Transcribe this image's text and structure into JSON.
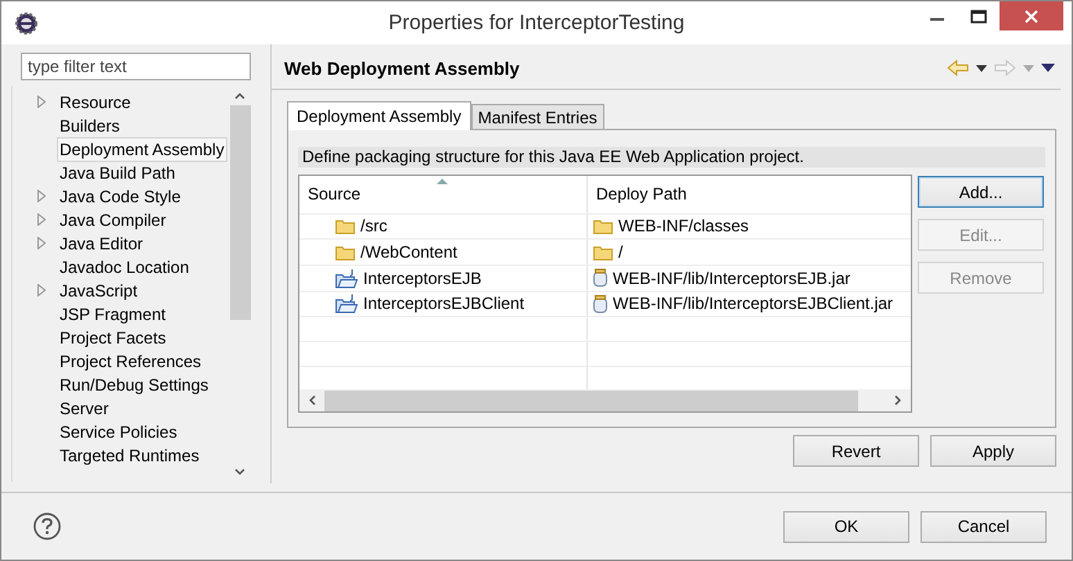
{
  "window": {
    "title": "Properties for InterceptorTesting"
  },
  "filter": {
    "placeholder": "type filter text"
  },
  "sidebar": {
    "items": [
      {
        "label": "Resource",
        "expandable": true,
        "selected": false
      },
      {
        "label": "Builders",
        "expandable": false,
        "selected": false
      },
      {
        "label": "Deployment Assembly",
        "expandable": false,
        "selected": true
      },
      {
        "label": "Java Build Path",
        "expandable": false,
        "selected": false
      },
      {
        "label": "Java Code Style",
        "expandable": true,
        "selected": false
      },
      {
        "label": "Java Compiler",
        "expandable": true,
        "selected": false
      },
      {
        "label": "Java Editor",
        "expandable": true,
        "selected": false
      },
      {
        "label": "Javadoc Location",
        "expandable": false,
        "selected": false
      },
      {
        "label": "JavaScript",
        "expandable": true,
        "selected": false
      },
      {
        "label": "JSP Fragment",
        "expandable": false,
        "selected": false
      },
      {
        "label": "Project Facets",
        "expandable": false,
        "selected": false
      },
      {
        "label": "Project References",
        "expandable": false,
        "selected": false
      },
      {
        "label": "Run/Debug Settings",
        "expandable": false,
        "selected": false
      },
      {
        "label": "Server",
        "expandable": false,
        "selected": false
      },
      {
        "label": "Service Policies",
        "expandable": false,
        "selected": false
      },
      {
        "label": "Targeted Runtimes",
        "expandable": false,
        "selected": false
      }
    ]
  },
  "page": {
    "title": "Web Deployment Assembly",
    "tabs": [
      {
        "label": "Deployment Assembly",
        "selected": true
      },
      {
        "label": "Manifest Entries",
        "selected": false
      }
    ],
    "description": "Define packaging structure for this Java EE Web Application project.",
    "table": {
      "columns": [
        "Source",
        "Deploy Path"
      ],
      "rows": [
        {
          "source": {
            "label": "/src",
            "kind": "folder"
          },
          "path": {
            "label": "WEB-INF/classes",
            "kind": "folder"
          }
        },
        {
          "source": {
            "label": "/WebContent",
            "kind": "folder"
          },
          "path": {
            "label": "/",
            "kind": "folder"
          }
        },
        {
          "source": {
            "label": "InterceptorsEJB",
            "kind": "project"
          },
          "path": {
            "label": "WEB-INF/lib/InterceptorsEJB.jar",
            "kind": "jar"
          }
        },
        {
          "source": {
            "label": "InterceptorsEJBClient",
            "kind": "project"
          },
          "path": {
            "label": "WEB-INF/lib/InterceptorsEJBClient.jar",
            "kind": "jar"
          }
        }
      ]
    },
    "side_buttons": [
      {
        "label": "Add...",
        "disabled": false,
        "focused": true
      },
      {
        "label": "Edit...",
        "disabled": true,
        "focused": false
      },
      {
        "label": "Remove",
        "disabled": true,
        "focused": false
      }
    ],
    "page_buttons": [
      "Revert",
      "Apply"
    ]
  },
  "dialog_buttons": [
    "OK",
    "Cancel"
  ]
}
